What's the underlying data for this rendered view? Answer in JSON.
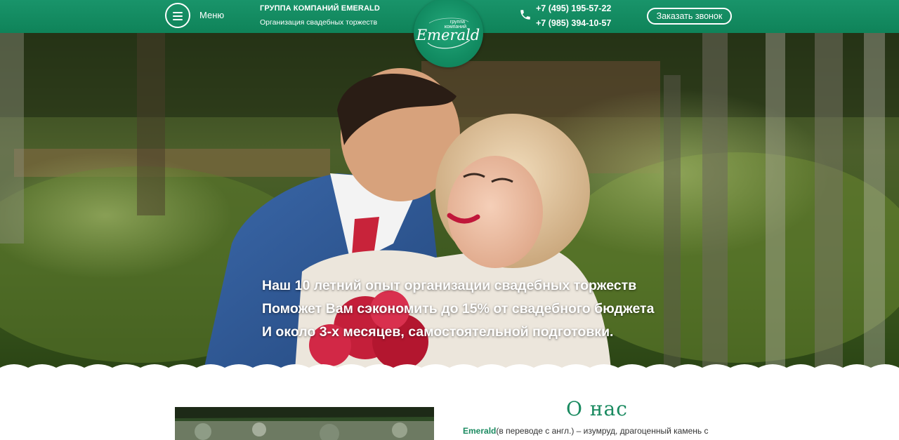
{
  "header": {
    "menu_label": "Меню",
    "company_name": "ГРУППА КОМПАНИЙ EMERALD",
    "company_subtitle": "Организация свадебных торжеств",
    "logo_script": "Emerald",
    "logo_small_1": "группа",
    "logo_small_2": "компаний",
    "phone_1": "+7 (495) 195-57-22",
    "phone_2": "+7 (985) 394-10-57",
    "callback_label": "Заказать звонок",
    "accent_color": "#138c62"
  },
  "hero": {
    "line_1": "Наш 10 летний опыт организации свадебных торжеств",
    "line_2": "Поможет Вам сэкономить до 15% от свадебного бюджета",
    "line_3": "И около 3-х месяцев, самостоятельной подготовки."
  },
  "about": {
    "title": "О нас",
    "brand": "Emerald",
    "text": "(в переводе с англ.) – изумруд, драгоценный камень с"
  }
}
